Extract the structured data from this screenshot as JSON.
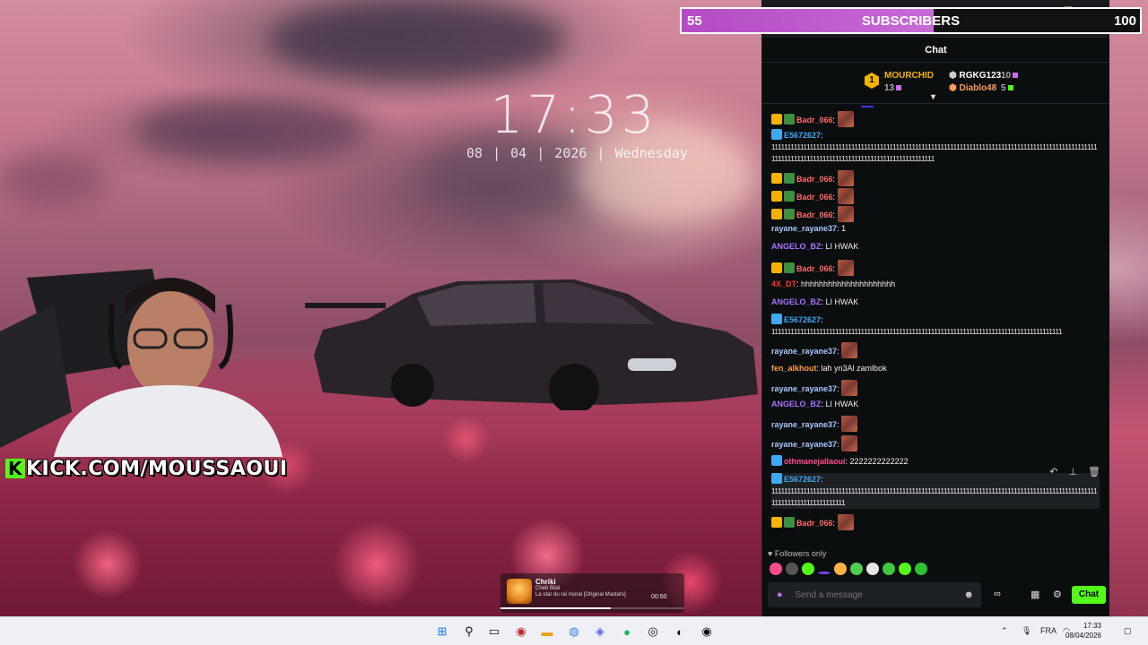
{
  "desktop": {
    "clock_time": "17:33",
    "clock_date": "08  |  04  |  2026  |  Wednesday"
  },
  "overlay": {
    "kick_text": "KICK.COM/MOUSSAOUI",
    "sub_current": "55",
    "sub_title": "SUBSCRIBERS",
    "sub_target": "100",
    "sub_progress": 0.55
  },
  "chat": {
    "header": "Chat",
    "leaderboard": [
      {
        "rank": "1",
        "user": "MOURCHID",
        "count": "13"
      },
      {
        "user": "RGKG123",
        "count": "10"
      },
      {
        "user": "Diablo48",
        "count": "5"
      }
    ],
    "messages": [
      {
        "user": "Badr_066",
        "color": "#ff6b6b",
        "text": "",
        "emote": true,
        "badges": "crown"
      },
      {
        "user": "E5672627",
        "color": "#3fa9f5",
        "text": "",
        "long": "111111111111111111111111111111111111111111111111111111111111111111111111111111111111111111111111111111111111111111111111111111111111111111111111111111111",
        "badges": "sub"
      },
      {
        "user": "Badr_066",
        "color": "#ff6b6b",
        "text": "",
        "emote": true,
        "badges": "crown"
      },
      {
        "user": "Badr_066",
        "color": "#ff6b6b",
        "text": "",
        "emote": true,
        "badges": "crown"
      },
      {
        "user": "Badr_066",
        "color": "#ff6b6b",
        "text": "",
        "emote": true,
        "badges": "crown"
      },
      {
        "user": "rayane_rayane37",
        "color": "#a9c7ff",
        "text": "1"
      },
      {
        "user": "ANGELO_BZ",
        "color": "#a970ff",
        "text": "LI HWAK"
      },
      {
        "user": "Badr_066",
        "color": "#ff6b6b",
        "text": "",
        "emote": true,
        "badges": "crown"
      },
      {
        "user": "4X_DT",
        "color": "#ff3030",
        "text": "hhhhhhhhhhhhhhhhhhhhh"
      },
      {
        "user": "ANGELO_BZ",
        "color": "#a970ff",
        "text": "LI HWAK"
      },
      {
        "user": "E5672627",
        "color": "#3fa9f5",
        "text": "",
        "long": "1111111111111111111111111111111111111111111111111111111111111111111111111111111111111111111",
        "badges": "sub"
      },
      {
        "user": "rayane_rayane37",
        "color": "#a9c7ff",
        "text": "",
        "emote": true
      },
      {
        "user": "fen_alkhout",
        "color": "#ff9a3c",
        "text": "lah yn3Al zamlbok"
      },
      {
        "user": "rayane_rayane37",
        "color": "#a9c7ff",
        "text": "",
        "emote": true
      },
      {
        "user": "ANGELO_BZ",
        "color": "#a970ff",
        "text": "LI HWAK"
      },
      {
        "user": "rayane_rayane37",
        "color": "#a9c7ff",
        "text": "",
        "emote": true
      },
      {
        "user": "rayane_rayane37",
        "color": "#a9c7ff",
        "text": "",
        "emote": true
      },
      {
        "user": "othmanejallaoui",
        "color": "#ff4d8d",
        "text": "2222222222222",
        "badges": "sub"
      },
      {
        "user": "E5672627",
        "color": "#3fa9f5",
        "text": "",
        "long": "11111111111111111111111111111111111111111111111111111111111111111111111111111111111111111111111111111111111111111111111111111",
        "badges": "sub"
      },
      {
        "user": "Badr_066",
        "color": "#ff6b6b",
        "text": "",
        "emote": true,
        "badges": "crown"
      }
    ],
    "followers_only": "Followers only",
    "input_placeholder": "Send a message",
    "send_button": "Chat"
  },
  "music": {
    "title": "Chriki",
    "artist": "Cheb Bilal",
    "album": "La star du raï moral [Original Masters]",
    "time": "00:50",
    "progress": 0.6
  },
  "taskbar": {
    "language": "FRA",
    "time": "17:33",
    "date": "08/04/2026"
  },
  "colors": {
    "kick_green": "#53fc18",
    "sub_bar": "#b44bc3"
  }
}
